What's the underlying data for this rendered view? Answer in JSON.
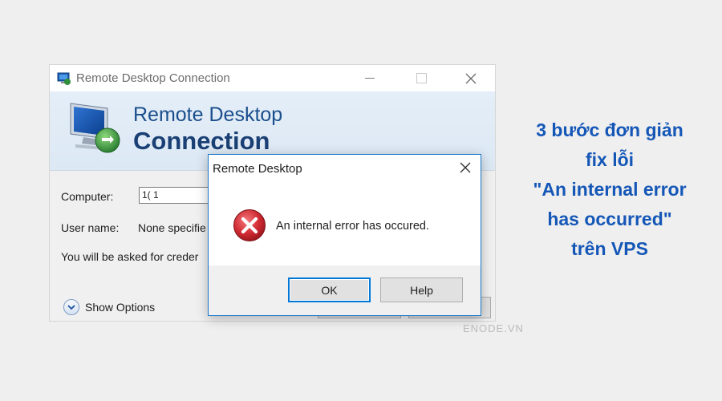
{
  "rdc_window": {
    "title": "Remote Desktop Connection",
    "banner_line1": "Remote Desktop",
    "banner_line2": "Connection",
    "form": {
      "computer_label": "Computer:",
      "computer_value": "1(          1",
      "username_label": "User name:",
      "username_value": "None specifie",
      "credentials_note": "You will be asked for creder"
    },
    "show_options_label": "Show Options"
  },
  "dialog": {
    "title": "Remote Desktop",
    "message": "An internal error has occured.",
    "ok_label": "OK",
    "help_label": "Help"
  },
  "headline": {
    "lines": [
      "3 bước đơn giản",
      "fix lỗi",
      "\"An internal error",
      "has occurred\"",
      "trên VPS"
    ]
  },
  "watermark": "ENODE.VN",
  "colors": {
    "headline": "#1557b7",
    "banner_text": "#1a3f74",
    "dialog_border": "#1979ca",
    "error_red": "#c8232c"
  },
  "icons": {
    "window_icon": "remote-desktop-icon",
    "banner_logo": "remote-desktop-monitor-icon",
    "error": "error-x-icon",
    "show_options": "chevron-down-circle-icon"
  }
}
